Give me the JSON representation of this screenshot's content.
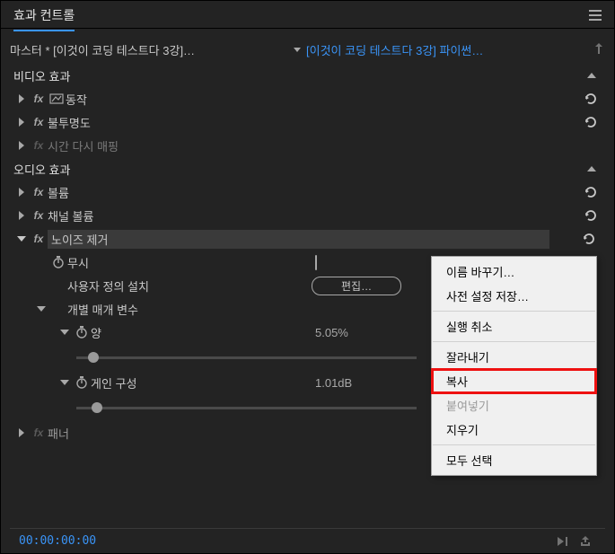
{
  "panel": {
    "title": "효과 컨트롤"
  },
  "clip": {
    "master": "마스터 * [이것이 코딩 테스트다 3강]…",
    "sequence": "[이것이 코딩 테스트다 3강] 파이썬…"
  },
  "sections": {
    "video": "비디오 효과",
    "audio": "오디오 효과"
  },
  "videoEffects": {
    "motion": "동작",
    "opacity": "불투명도",
    "timeRemap": "시간 다시 매핑"
  },
  "audioEffects": {
    "volume": "볼륨",
    "channelVolume": "채널 볼륨",
    "noiseReduction": "노이즈 제거",
    "panner": "패너"
  },
  "noise": {
    "bypass": "무시",
    "customSetup": "사용자 정의 설치",
    "editBtn": "편집…",
    "individualParams": "개별 매개 변수",
    "amount": {
      "label": "양",
      "value": "5.05%"
    },
    "gain": {
      "label": "게인 구성",
      "value": "1.01dB"
    }
  },
  "timecode": "00:00:00:00",
  "contextMenu": {
    "rename": "이름 바꾸기…",
    "savePreset": "사전 설정 저장…",
    "undo": "실행 취소",
    "cut": "잘라내기",
    "copy": "복사",
    "paste": "붙여넣기",
    "clear": "지우기",
    "selectAll": "모두 선택"
  }
}
